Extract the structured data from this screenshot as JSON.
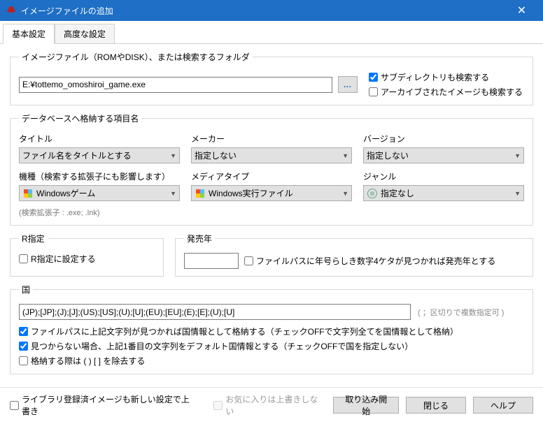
{
  "window": {
    "title": "イメージファイルの追加"
  },
  "tabs": {
    "basic": "基本設定",
    "advanced": "高度な設定"
  },
  "sec_image": {
    "legend": "イメージファイル（ROMやDISK）、または検索するフォルダ",
    "path": "E:¥tottemo_omoshiroi_game.exe",
    "recurse": "サブディレクトリも検索する",
    "archives": "アーカイブされたイメージも検索する"
  },
  "sec_db": {
    "legend": "データベースへ格納する項目名",
    "title_label": "タイトル",
    "title_value": "ファイル名をタイトルとする",
    "maker_label": "メーカー",
    "maker_value": "指定しない",
    "version_label": "バージョン",
    "version_value": "指定しない",
    "machine_label": "機種（検索する拡張子にも影響します）",
    "machine_value": "Windowsゲーム",
    "media_label": "メディアタイプ",
    "media_value": "Windows実行ファイル",
    "genre_label": "ジャンル",
    "genre_value": "指定なし",
    "ext_hint": "(検索拡張子 : .exe; .lnk)"
  },
  "sec_r": {
    "legend": "R指定",
    "checkbox": "R指定に設定する"
  },
  "sec_year": {
    "legend": "発売年",
    "checkbox": "ファイルパスに年号らしき数字4ケタが見つかれば発売年とする"
  },
  "sec_country": {
    "legend": "国",
    "value": "(JP);[JP];(J);[J];(US);[US];(U);[U];(EU);[EU];(E);[E];(U);[U]",
    "note": "( ；区切りで複数指定可 )",
    "cb1": "ファイルパスに上記文字列が見つかれば国情報として格納する（チェックOFFで文字列全てを国情報として格納）",
    "cb2": "見つからない場合、上記1番目の文字列をデフォルト国情報とする（チェックOFFで国を指定しない）",
    "cb3": "格納する際は ( ) [ ] を除去する"
  },
  "bottom": {
    "overwrite_new": "ライブラリ登録済イメージも新しい設定で上書き",
    "keep_fav": "お気に入りは上書きしない",
    "import": "取り込み開始",
    "close": "閉じる",
    "help": "ヘルプ"
  }
}
